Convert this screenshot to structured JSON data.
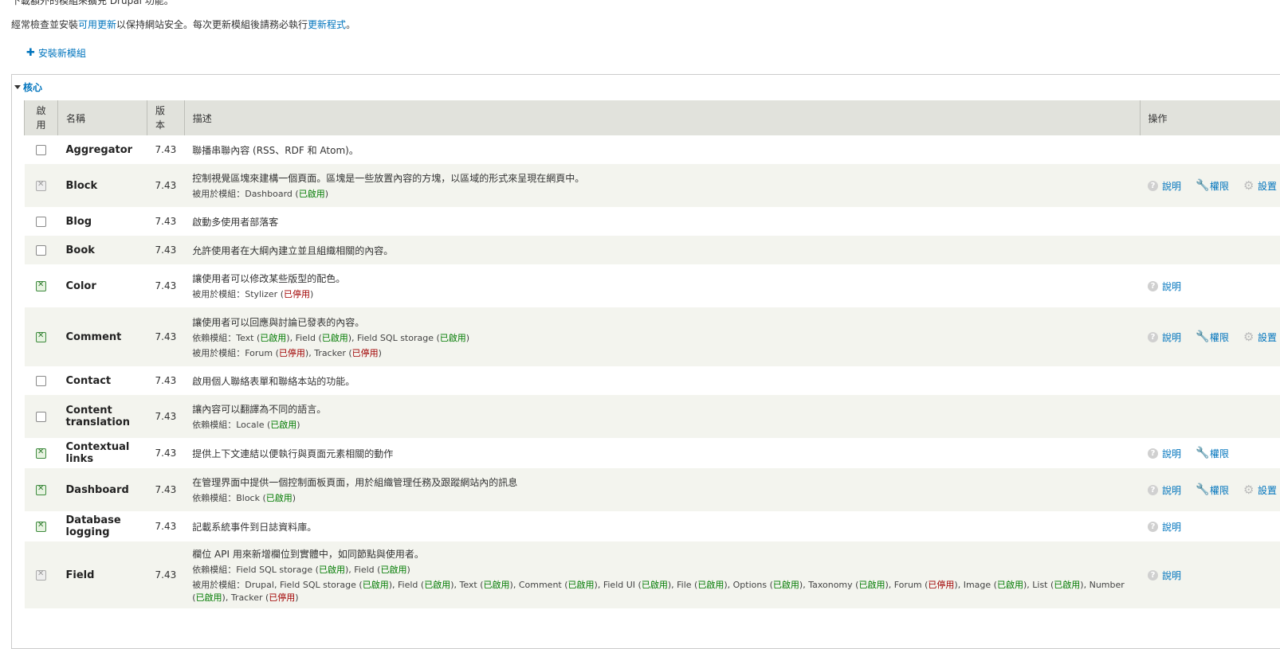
{
  "top_text": "下載額外的模組來擴充 Drupal 功能。",
  "intro": {
    "prefix": "經常檢查並安裝",
    "link1": "可用更新",
    "middle": "以保持網站安全。每次更新模組後請務必執行",
    "link2": "更新程式",
    "suffix": "。"
  },
  "install_link": "安裝新模組",
  "section_title": "核心",
  "headers": {
    "enabled": "啟用",
    "name": "名稱",
    "version": "版本",
    "description": "描述",
    "operations": "操作"
  },
  "ops_labels": {
    "help": "說明",
    "perm": "權限",
    "config": "設置"
  },
  "modules": [
    {
      "state": "off",
      "name": "Aggregator",
      "version": "7.43",
      "desc": "聯播串聯內容 (RSS、RDF 和 Atom)。",
      "lines": [],
      "ops": []
    },
    {
      "state": "lock",
      "name": "Block",
      "version": "7.43",
      "desc": "控制視覺區塊來建構一個頁面。區塊是一些放置內容的方塊，以區域的形式來呈現在網頁中。",
      "lines": [
        {
          "label": "被用於模組：",
          "items": [
            {
              "n": "Dashboard",
              "s": "已啟用",
              "c": "en"
            }
          ]
        }
      ],
      "ops": [
        "help",
        "perm",
        "config"
      ]
    },
    {
      "state": "off",
      "name": "Blog",
      "version": "7.43",
      "desc": "啟動多使用者部落客",
      "lines": [],
      "ops": []
    },
    {
      "state": "off",
      "name": "Book",
      "version": "7.43",
      "desc": "允許使用者在大綱內建立並且組織相關的內容。",
      "lines": [],
      "ops": []
    },
    {
      "state": "on",
      "name": "Color",
      "version": "7.43",
      "desc": "讓使用者可以修改某些版型的配色。",
      "lines": [
        {
          "label": "被用於模組：",
          "items": [
            {
              "n": "Stylizer",
              "s": "已停用",
              "c": "dis"
            }
          ]
        }
      ],
      "ops": [
        "help"
      ]
    },
    {
      "state": "on",
      "name": "Comment",
      "version": "7.43",
      "desc": "讓使用者可以回應與討論已發表的內容。",
      "lines": [
        {
          "label": "依賴模組：",
          "items": [
            {
              "n": "Text",
              "s": "已啟用",
              "c": "en"
            },
            {
              "n": "Field",
              "s": "已啟用",
              "c": "en"
            },
            {
              "n": "Field SQL storage",
              "s": "已啟用",
              "c": "en"
            }
          ]
        },
        {
          "label": "被用於模組：",
          "items": [
            {
              "n": "Forum",
              "s": "已停用",
              "c": "dis"
            },
            {
              "n": "Tracker",
              "s": "已停用",
              "c": "dis"
            }
          ]
        }
      ],
      "ops": [
        "help",
        "perm",
        "config"
      ]
    },
    {
      "state": "off",
      "name": "Contact",
      "version": "7.43",
      "desc": "啟用個人聯絡表單和聯絡本站的功能。",
      "lines": [],
      "ops": []
    },
    {
      "state": "off",
      "name": "Content translation",
      "version": "7.43",
      "desc": "讓內容可以翻譯為不同的語言。",
      "lines": [
        {
          "label": "依賴模組：",
          "items": [
            {
              "n": "Locale",
              "s": "已啟用",
              "c": "en"
            }
          ]
        }
      ],
      "ops": []
    },
    {
      "state": "on",
      "name": "Contextual links",
      "version": "7.43",
      "desc": "提供上下文連結以便執行與頁面元素相關的動作",
      "lines": [],
      "ops": [
        "help",
        "perm"
      ]
    },
    {
      "state": "on",
      "name": "Dashboard",
      "version": "7.43",
      "desc": "在管理界面中提供一個控制面板頁面，用於組織管理任務及跟蹤網站內的訊息",
      "lines": [
        {
          "label": "依賴模組：",
          "items": [
            {
              "n": "Block",
              "s": "已啟用",
              "c": "en"
            }
          ]
        }
      ],
      "ops": [
        "help",
        "perm",
        "config"
      ]
    },
    {
      "state": "on",
      "name": "Database logging",
      "version": "7.43",
      "desc": "記載系統事件到日誌資料庫。",
      "lines": [],
      "ops": [
        "help"
      ]
    },
    {
      "state": "lock",
      "name": "Field",
      "version": "7.43",
      "desc": "欄位 API 用來新增欄位到實體中，如同節點與使用者。",
      "lines": [
        {
          "label": "依賴模組：",
          "items": [
            {
              "n": "Field SQL storage",
              "s": "已啟用",
              "c": "en"
            },
            {
              "n": "Field",
              "s": "已啟用",
              "c": "en"
            }
          ]
        },
        {
          "label": "被用於模組：",
          "items": [
            {
              "n": "Drupal",
              "s": "",
              "c": ""
            },
            {
              "n": "Field SQL storage",
              "s": "已啟用",
              "c": "en"
            },
            {
              "n": "Field",
              "s": "已啟用",
              "c": "en"
            },
            {
              "n": "Text",
              "s": "已啟用",
              "c": "en"
            },
            {
              "n": "Comment",
              "s": "已啟用",
              "c": "en"
            },
            {
              "n": "Field UI",
              "s": "已啟用",
              "c": "en"
            },
            {
              "n": "File",
              "s": "已啟用",
              "c": "en"
            },
            {
              "n": "Options",
              "s": "已啟用",
              "c": "en"
            },
            {
              "n": "Taxonomy",
              "s": "已啟用",
              "c": "en"
            },
            {
              "n": "Forum",
              "s": "已停用",
              "c": "dis"
            },
            {
              "n": "Image",
              "s": "已啟用",
              "c": "en"
            },
            {
              "n": "List",
              "s": "已啟用",
              "c": "en"
            },
            {
              "n": "Number",
              "s": "已啟用",
              "c": "en"
            },
            {
              "n": "Tracker",
              "s": "已停用",
              "c": "dis"
            }
          ]
        }
      ],
      "ops": [
        "help"
      ]
    }
  ]
}
